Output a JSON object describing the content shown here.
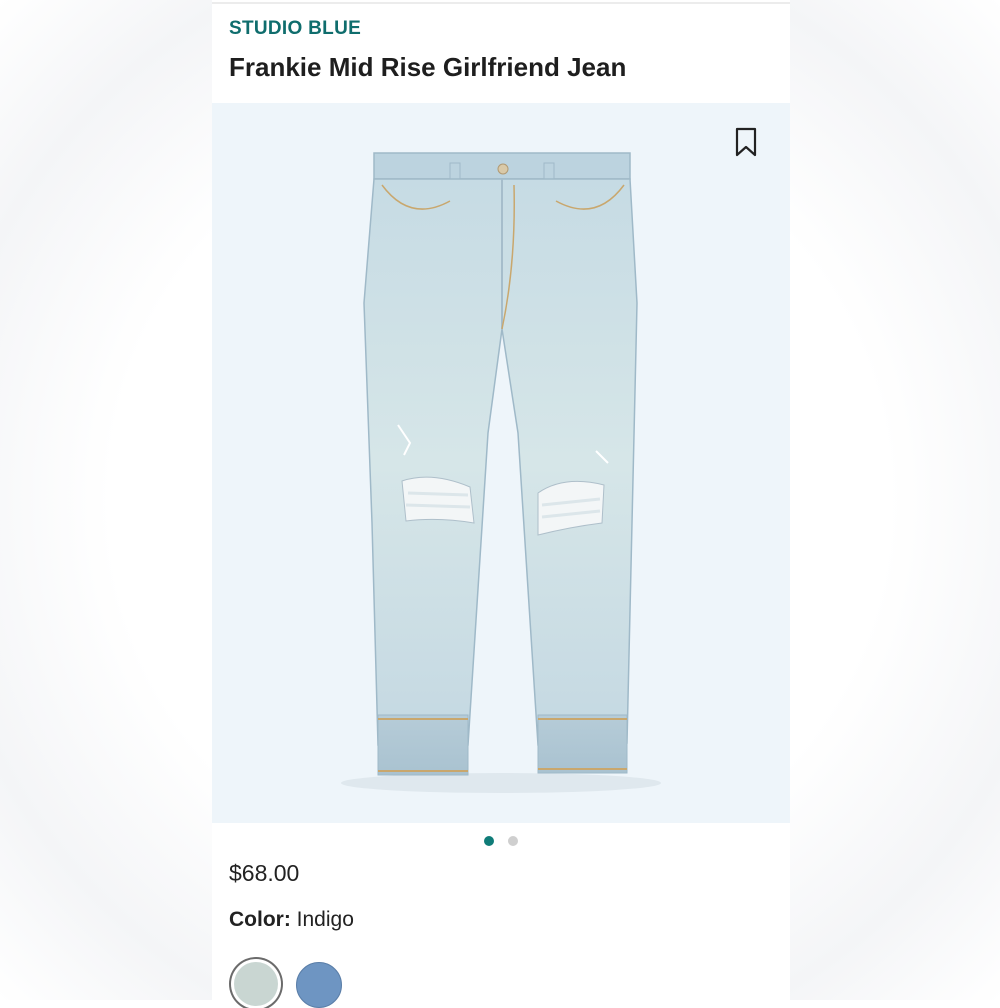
{
  "product": {
    "brand": "STUDIO BLUE",
    "title": "Frankie Mid Rise Girlfriend Jean",
    "price": "$68.00",
    "color_label": "Color:",
    "color_value": "Indigo"
  },
  "gallery": {
    "image_count": 2,
    "active_index": 0,
    "bookmark_icon": "bookmark-icon"
  },
  "swatches": [
    {
      "name": "light-wash",
      "color": "#c9d6d2",
      "selected": true
    },
    {
      "name": "indigo",
      "color": "#6e95c2",
      "selected": false
    }
  ],
  "colors": {
    "brand": "#0f6d6d",
    "carousel_active": "#0f7c78",
    "carousel_inactive": "#cfcfcf",
    "photo_background": "#eef5fa"
  }
}
